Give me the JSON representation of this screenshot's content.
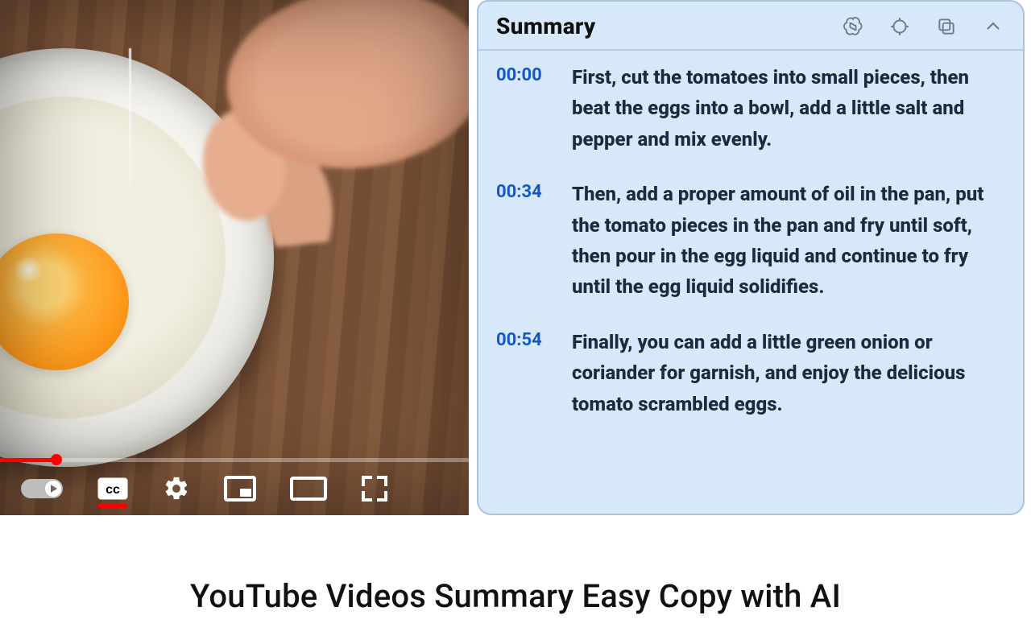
{
  "panel": {
    "title": "Summary"
  },
  "items": [
    {
      "time": "00:00",
      "text": "First, cut the tomatoes into small pieces, then beat the eggs into a bowl, add a little salt and pepper and mix evenly."
    },
    {
      "time": "00:34",
      "text": "Then, add a proper amount of oil in the pan, put the tomato pieces in the pan and fry until soft, then pour in the egg liquid and continue to fry until the egg liquid solidifies."
    },
    {
      "time": "00:54",
      "text": "Finally, you can add a little green onion or coriander for garnish, and enjoy the delicious tomato scrambled eggs."
    }
  ],
  "caption": "YouTube Videos Summary Easy Copy with AI"
}
